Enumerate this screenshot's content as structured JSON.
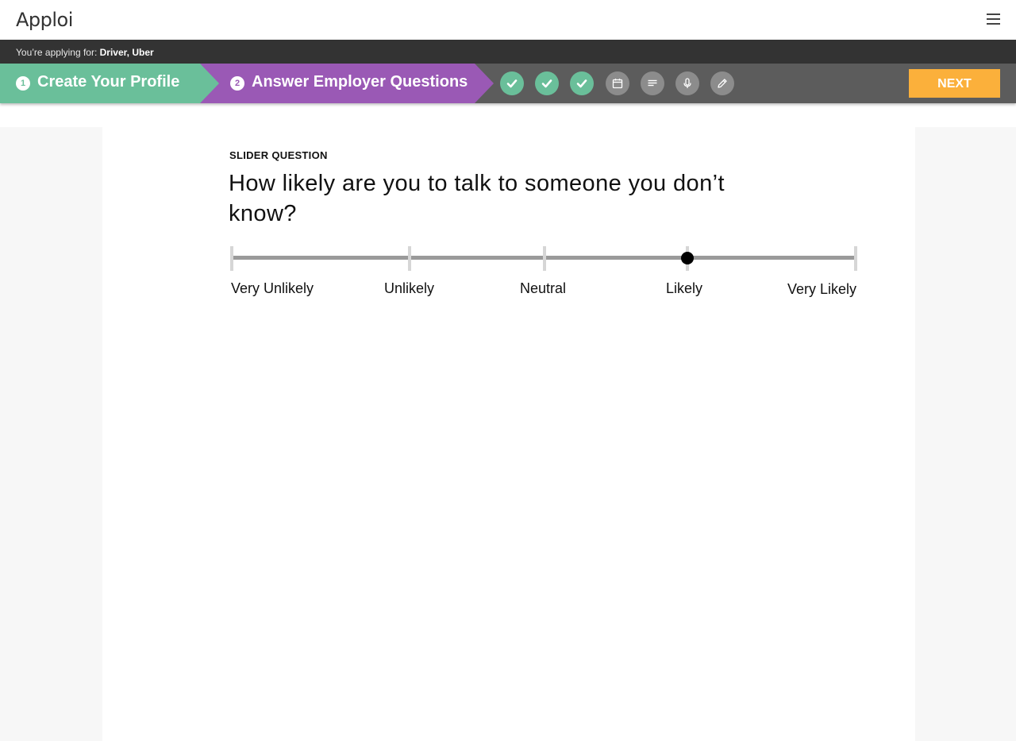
{
  "header": {
    "logo_text": "Apploi",
    "menu_icon": "hamburger-menu-icon"
  },
  "apply_bar": {
    "prefix": "You’re applying for:",
    "job": "Driver, Uber"
  },
  "steps": {
    "step1": {
      "number": "1",
      "label": "Create Your Profile"
    },
    "step2": {
      "number": "2",
      "label": "Answer Employer Questions"
    },
    "substeps": [
      {
        "icon": "checkmark-icon",
        "status": "done"
      },
      {
        "icon": "checkmark-icon",
        "status": "done"
      },
      {
        "icon": "checkmark-icon",
        "status": "done"
      },
      {
        "icon": "calendar-icon",
        "status": "todo"
      },
      {
        "icon": "text-lines-icon",
        "status": "todo"
      },
      {
        "icon": "microphone-icon",
        "status": "todo"
      },
      {
        "icon": "pencil-icon",
        "status": "todo"
      }
    ],
    "next_label": "NEXT"
  },
  "question": {
    "type_label": "SLIDER QUESTION",
    "text": "How likely are you to talk to someone you don’t know?",
    "options": [
      "Very Unlikely",
      "Unlikely",
      "Neutral",
      "Likely",
      "Very Likely"
    ],
    "selected_index": 3
  },
  "colors": {
    "profile_step": "#6abf9a",
    "questions_step": "#9a59b5",
    "stepbar": "#5c5c5c",
    "next_button": "#fbb03b",
    "done_substep": "#6abf9a",
    "todo_substep": "#8c8c8c"
  }
}
